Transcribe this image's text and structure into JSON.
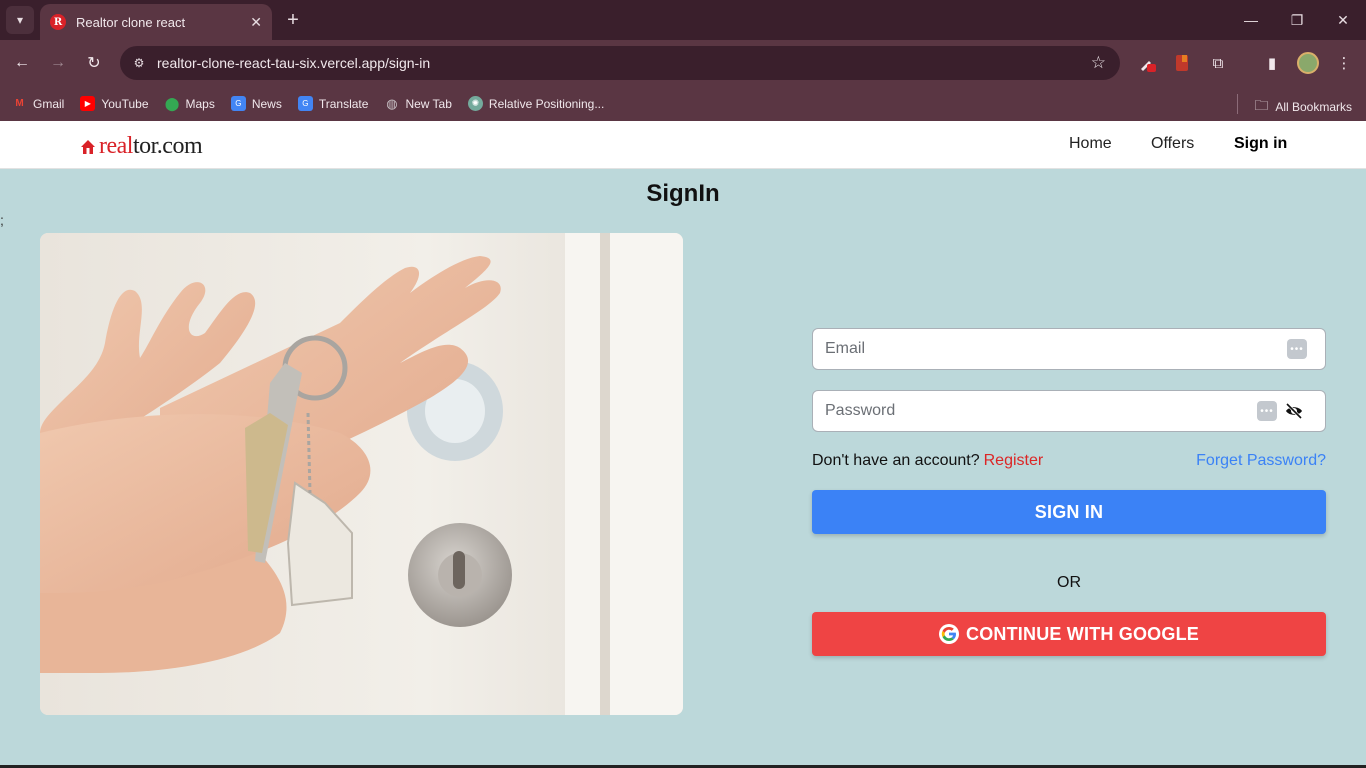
{
  "browser": {
    "tab_title": "Realtor clone react",
    "favicon_letter": "R",
    "url": "realtor-clone-react-tau-six.vercel.app/sign-in",
    "bookmarks": [
      {
        "label": "Gmail",
        "icon": "gmail-icon",
        "color": "#ea4335"
      },
      {
        "label": "YouTube",
        "icon": "youtube-icon",
        "color": "#ff0000"
      },
      {
        "label": "Maps",
        "icon": "maps-icon",
        "color": "#34a853"
      },
      {
        "label": "News",
        "icon": "news-icon",
        "color": "#4285f4"
      },
      {
        "label": "Translate",
        "icon": "translate-icon",
        "color": "#4285f4"
      },
      {
        "label": "New Tab",
        "icon": "globe-icon",
        "color": "#c9c2c6"
      },
      {
        "label": "Relative Positioning...",
        "icon": "chatgpt-icon",
        "color": "#74aa9c"
      }
    ],
    "all_bookmarks": "All Bookmarks"
  },
  "header": {
    "logo_red": "real",
    "logo_dark": "tor.com",
    "nav": [
      {
        "label": "Home"
      },
      {
        "label": "Offers"
      },
      {
        "label": "Sign in"
      }
    ]
  },
  "main": {
    "title": "SignIn",
    "stray_char": ";",
    "email_placeholder": "Email",
    "password_placeholder": "Password",
    "no_account_text": "Don't have an account?",
    "register_link": "Register",
    "forgot_link": "Forget Password?",
    "signin_button": "SIGN IN",
    "or_text": "OR",
    "google_button": "CONTINUE WITH GOOGLE"
  },
  "colors": {
    "page_bg": "#bcd8da",
    "primary": "#3b82f6",
    "google_btn": "#ef4444",
    "brand_red": "#d92228"
  }
}
